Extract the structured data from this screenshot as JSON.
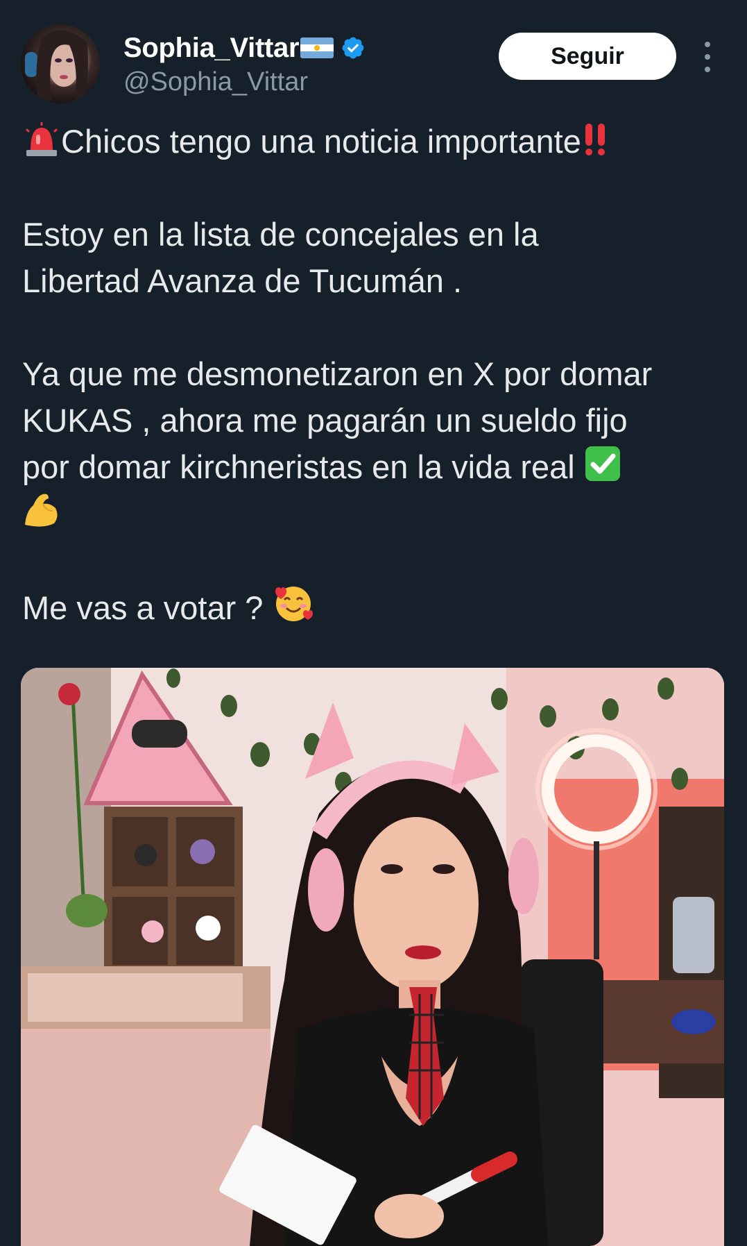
{
  "author": {
    "display_name": "Sophia_Vittar",
    "handle": "@Sophia_Vittar",
    "flag": "argentina-flag-icon",
    "verified": true
  },
  "actions": {
    "follow_label": "Seguir",
    "more_icon": "more-vertical-icon"
  },
  "tweet": {
    "line1": "Chicos tengo una noticia importante",
    "line2a": "Estoy en la lista de concejales en la",
    "line2b": "Libertad Avanza de Tucumán .",
    "line3a": "Ya que me desmonetizaron en X por domar",
    "line3b": "KUKAS , ahora me pagarán un sueldo fijo",
    "line3c": "por domar kirchneristas en la vida real",
    "line4": "Me vas a votar ?"
  },
  "colors": {
    "background": "#15202b",
    "text": "#e7e9ea",
    "secondary": "#8b98a5",
    "verified": "#1d9bf0"
  }
}
